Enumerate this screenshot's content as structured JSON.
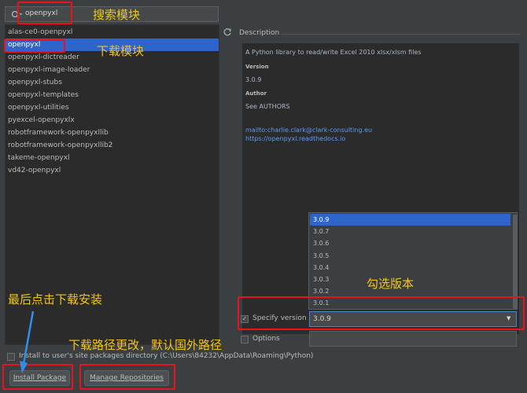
{
  "search": {
    "value": "openpyxl",
    "icon": "search-icon"
  },
  "package_list": [
    "alas-ce0-openpyxl",
    "openpyxl",
    "openpyxl-dictreader",
    "openpyxl-image-loader",
    "openpyxl-stubs",
    "openpyxl-templates",
    "openpyxl-utilities",
    "pyexcel-openpyxlx",
    "robotframework-openpyxllib",
    "robotframework-openpyxllib2",
    "takeme-openpyxl",
    "vd42-openpyxl"
  ],
  "selected_package_index": 1,
  "description": {
    "label": "Description",
    "summary": "A Python library to read/write Excel 2010 xlsx/xlsm files",
    "version_heading": "Version",
    "version": "3.0.9",
    "author_heading": "Author",
    "author": "See AUTHORS",
    "email_link": "mailto:charlie.clark@clark-consulting.eu",
    "docs_link": "https://openpyxl.readthedocs.io"
  },
  "versions": [
    "3.0.9",
    "3.0.7",
    "3.0.6",
    "3.0.5",
    "3.0.4",
    "3.0.3",
    "3.0.2",
    "3.0.1"
  ],
  "specify_version": {
    "label": "Specify version",
    "checked": true,
    "value": "3.0.9"
  },
  "options": {
    "label": "Options",
    "checked": false
  },
  "install_user": {
    "label": "Install to user's site packages directory (C:\\Users\\84232\\AppData\\Roaming\\Python)",
    "checked": false
  },
  "buttons": {
    "install": "Install Package",
    "manage": "Manage Repositories"
  },
  "annotations": {
    "search_module": "搜索模块",
    "download_module": "下载模块",
    "select_version": "勾选版本",
    "click_install": "最后点击下载安装",
    "path_change": "下载路径更改，默认国外路径"
  },
  "colors": {
    "accent": "#2f65ca",
    "annotation_box": "#e8141b",
    "annotation_text": "#f2c51b",
    "link": "#589df6"
  }
}
